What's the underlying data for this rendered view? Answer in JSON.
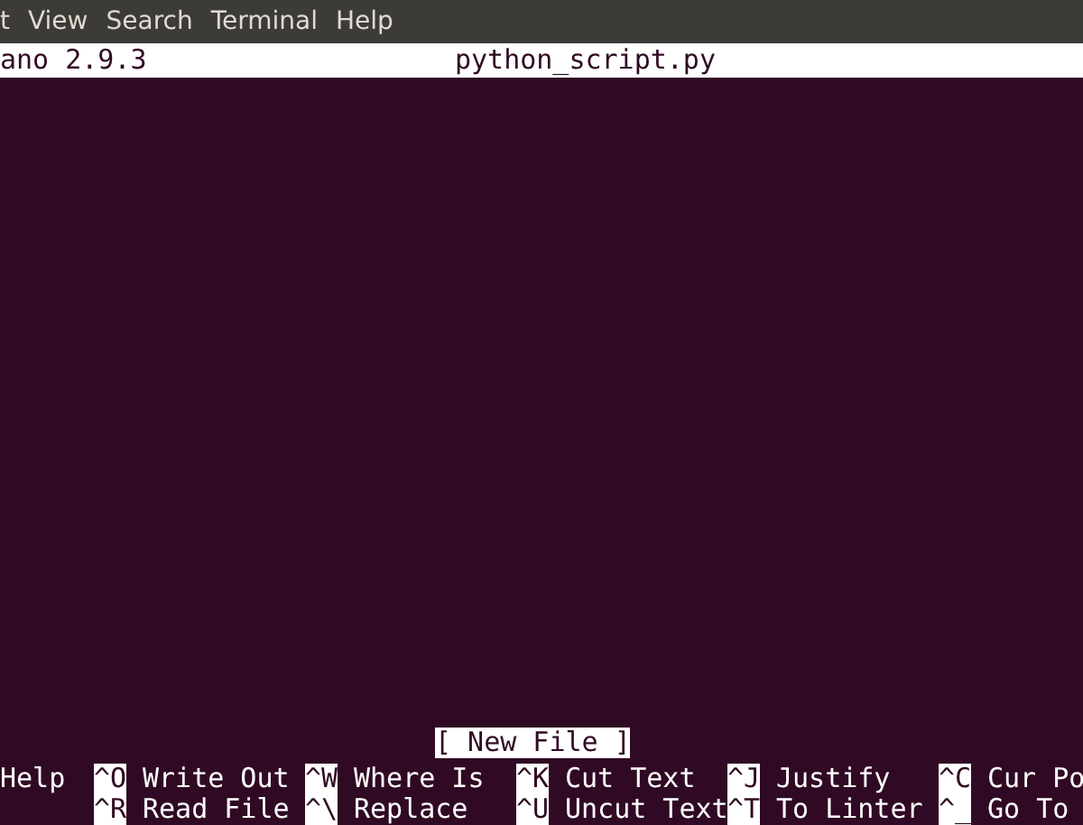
{
  "menu_bar": {
    "items": [
      "t",
      "View",
      "Search",
      "Terminal",
      "Help"
    ]
  },
  "title_bar": {
    "version": "ano 2.9.3",
    "filename": "python_script.py"
  },
  "status": "[ New File ]",
  "shortcut_rows": [
    [
      {
        "label": "Help"
      },
      {
        "key": "^O",
        "label": "Write Out"
      },
      {
        "key": "^W",
        "label": "Where Is"
      },
      {
        "key": "^K",
        "label": "Cut Text"
      },
      {
        "key": "^J",
        "label": "Justify"
      },
      {
        "key": "^C",
        "label": "Cur Po"
      }
    ],
    [
      {},
      {
        "key": "^R",
        "label": "Read File"
      },
      {
        "key": "^\\",
        "label": "Replace"
      },
      {
        "key": "^U",
        "label": "Uncut Text"
      },
      {
        "key": "^T",
        "label": "To Linter"
      },
      {
        "key": "^_",
        "label": "Go To"
      }
    ]
  ]
}
